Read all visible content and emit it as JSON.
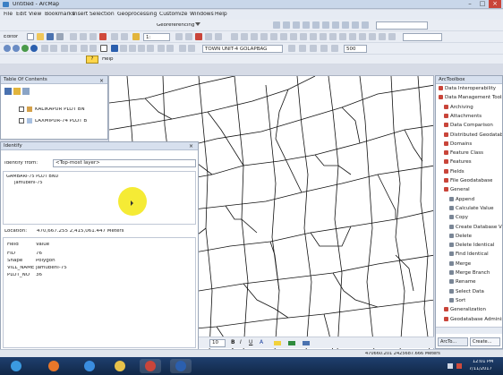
{
  "window": {
    "title": "Untitled - ArcMap"
  },
  "menu": [
    "File",
    "Edit",
    "View",
    "Bookmarks",
    "Insert",
    "Selection",
    "Geoprocessing",
    "Customize",
    "Windows",
    "Help"
  ],
  "toolbars": {
    "georeferencing_label": "Georeferencing",
    "editor_label": "Editor",
    "scale_value": "1:",
    "help_label": "Help",
    "layer_combo": "TOWN UNIT-4 GOLAPBAG",
    "zoom_value": "500"
  },
  "toc": {
    "title": "Table Of Contents",
    "layers": [
      "KALIKAPUR PLOT BN",
      "LAXMIPUR-74 PLOT B"
    ]
  },
  "identify": {
    "title": "Identify",
    "from_label": "Identify from:",
    "from_value": "<Top-most layer>",
    "tree_layer": "GAMBARI-75 PLOT BND",
    "tree_feature": "Jamubeni-75",
    "location_label": "Location:",
    "location_value": "470,667.255  2,415,061.447 Meters",
    "field_header": "Field",
    "value_header": "Value",
    "rows": [
      {
        "field": "FID",
        "value": "76"
      },
      {
        "field": "Shape",
        "value": "Polygon"
      },
      {
        "field": "VILL_NAME",
        "value": "Jamubeni-75"
      },
      {
        "field": "PLOT_NO",
        "value": "36"
      }
    ]
  },
  "toolbox": {
    "title": "ArcToolbox",
    "items": [
      {
        "label": "Data Interoperability",
        "indent": 0,
        "kind": "box"
      },
      {
        "label": "Data Management Tools",
        "indent": 0,
        "kind": "box"
      },
      {
        "label": "Archiving",
        "indent": 1,
        "kind": "box"
      },
      {
        "label": "Attachments",
        "indent": 1,
        "kind": "box"
      },
      {
        "label": "Data Comparison",
        "indent": 1,
        "kind": "box"
      },
      {
        "label": "Distributed Geodatabase",
        "indent": 1,
        "kind": "box"
      },
      {
        "label": "Domains",
        "indent": 1,
        "kind": "box"
      },
      {
        "label": "Feature Class",
        "indent": 1,
        "kind": "box"
      },
      {
        "label": "Features",
        "indent": 1,
        "kind": "box"
      },
      {
        "label": "Fields",
        "indent": 1,
        "kind": "box"
      },
      {
        "label": "File Geodatabase",
        "indent": 1,
        "kind": "box"
      },
      {
        "label": "General",
        "indent": 1,
        "kind": "box"
      },
      {
        "label": "Append",
        "indent": 2,
        "kind": "tool"
      },
      {
        "label": "Calculate Value",
        "indent": 2,
        "kind": "tool"
      },
      {
        "label": "Copy",
        "indent": 2,
        "kind": "tool"
      },
      {
        "label": "Create Database View",
        "indent": 2,
        "kind": "tool"
      },
      {
        "label": "Delete",
        "indent": 2,
        "kind": "tool"
      },
      {
        "label": "Delete Identical",
        "indent": 2,
        "kind": "tool"
      },
      {
        "label": "Find Identical",
        "indent": 2,
        "kind": "tool"
      },
      {
        "label": "Merge",
        "indent": 2,
        "kind": "tool"
      },
      {
        "label": "Merge Branch",
        "indent": 2,
        "kind": "tool"
      },
      {
        "label": "Rename",
        "indent": 2,
        "kind": "tool"
      },
      {
        "label": "Select Data",
        "indent": 2,
        "kind": "tool"
      },
      {
        "label": "Sort",
        "indent": 2,
        "kind": "tool"
      },
      {
        "label": "Generalization",
        "indent": 1,
        "kind": "box"
      },
      {
        "label": "Geodatabase Administration",
        "indent": 1,
        "kind": "box"
      }
    ],
    "tab1": "ArcTo...",
    "tab2": "Create..."
  },
  "draw": {
    "font_size": "10"
  },
  "status": {
    "coords": "470660.201  2425687.666 Meters"
  },
  "taskbar": {
    "time": "12:01 PM",
    "date": "7/11/2017"
  },
  "colors": {
    "accent": "#3b7fc4",
    "highlight": "#f4ea2a",
    "taskbar": "#1a355e"
  }
}
